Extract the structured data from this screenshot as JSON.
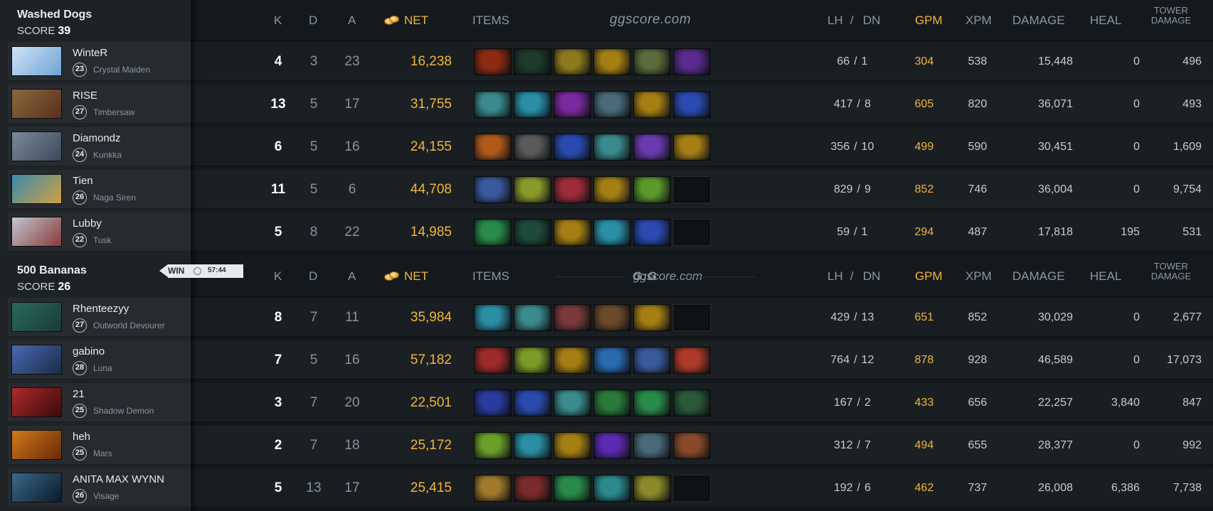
{
  "colors": {
    "gold": "#f2b53a",
    "header_gray": "#8e979e",
    "panel": "#262b2f",
    "background": "#14191d"
  },
  "watermark": {
    "top": "ggscore.com",
    "logo": "G:G",
    "logo_sub": "ggscore.com"
  },
  "columns": {
    "k": "K",
    "d": "D",
    "a": "A",
    "net": "NET",
    "items": "ITEMS",
    "lh": "LH",
    "slash": "/",
    "dn": "DN",
    "gpm": "GPM",
    "xpm": "XPM",
    "damage": "DAMAGE",
    "heal": "HEAL",
    "tower_line1": "TOWER",
    "tower_line2": "DAMAGE"
  },
  "result": {
    "label": "WIN",
    "icon": "clock-icon",
    "duration": "57:44"
  },
  "teams": [
    {
      "name": "Washed Dogs",
      "score_label": "SCORE",
      "score": "39",
      "players": [
        {
          "name": "WinteR",
          "level": "23",
          "hero": "Crystal Maiden",
          "avatar_colors": [
            "#cfe3f6",
            "#6fa3d6"
          ],
          "k": "4",
          "d": "3",
          "a": "23",
          "net": "16,238",
          "items": [
            "#8e2a12",
            "#1e3a2c",
            "#8e7a1e",
            "#a57f14",
            "#5b6b3a",
            "#5a2a8e"
          ],
          "lh": "66",
          "dn": "1",
          "gpm": "304",
          "xpm": "538",
          "damage": "15,448",
          "heal": "0",
          "tower": "496"
        },
        {
          "name": "RISE",
          "level": "27",
          "hero": "Timbersaw",
          "avatar_colors": [
            "#8a6a3a",
            "#5a2e1e"
          ],
          "k": "13",
          "d": "5",
          "a": "17",
          "net": "31,755",
          "items": [
            "#3a8a8e",
            "#2a8ea5",
            "#7a2a9e",
            "#4a6a7a",
            "#a57f14",
            "#2a4ab0"
          ],
          "lh": "417",
          "dn": "8",
          "gpm": "605",
          "xpm": "820",
          "damage": "36,071",
          "heal": "0",
          "tower": "493"
        },
        {
          "name": "Diamondz",
          "level": "24",
          "hero": "Kunkka",
          "avatar_colors": [
            "#7a8a9a",
            "#3a4a5a"
          ],
          "k": "6",
          "d": "5",
          "a": "16",
          "net": "24,155",
          "items": [
            "#b05a1a",
            "#5a5a5a",
            "#2a4ab0",
            "#3a8a8e",
            "#6a3ab0",
            "#a57f14"
          ],
          "lh": "356",
          "dn": "10",
          "gpm": "499",
          "xpm": "590",
          "damage": "30,451",
          "heal": "0",
          "tower": "1,609"
        },
        {
          "name": "Tien",
          "level": "26",
          "hero": "Naga Siren",
          "avatar_colors": [
            "#3a8ab0",
            "#d0a040"
          ],
          "k": "11",
          "d": "5",
          "a": "6",
          "net": "44,708",
          "items": [
            "#3a5a9e",
            "#8a9a2a",
            "#9e2a3a",
            "#a57f14",
            "#5a9a2a",
            ""
          ],
          "lh": "829",
          "dn": "9",
          "gpm": "852",
          "xpm": "746",
          "damage": "36,004",
          "heal": "0",
          "tower": "9,754"
        },
        {
          "name": "Lubby",
          "level": "22",
          "hero": "Tusk",
          "avatar_colors": [
            "#c0c8d0",
            "#8a3a3a"
          ],
          "k": "5",
          "d": "8",
          "a": "22",
          "net": "14,985",
          "items": [
            "#2a8a4a",
            "#1e4a3a",
            "#a57f14",
            "#2a8ea5",
            "#2a4ab0",
            ""
          ],
          "lh": "59",
          "dn": "1",
          "gpm": "294",
          "xpm": "487",
          "damage": "17,818",
          "heal": "195",
          "tower": "531"
        }
      ]
    },
    {
      "name": "500 Bananas",
      "score_label": "SCORE",
      "score": "26",
      "players": [
        {
          "name": "Rhenteezyy",
          "level": "27",
          "hero": "Outworld Devourer",
          "avatar_colors": [
            "#2a6a5a",
            "#1a3a3a"
          ],
          "k": "8",
          "d": "7",
          "a": "11",
          "net": "35,984",
          "items": [
            "#2a8ea5",
            "#3a8a8e",
            "#7a3a3a",
            "#6a4a2a",
            "#a57f14",
            ""
          ],
          "lh": "429",
          "dn": "13",
          "gpm": "651",
          "xpm": "852",
          "damage": "30,029",
          "heal": "0",
          "tower": "2,677"
        },
        {
          "name": "gabino",
          "level": "28",
          "hero": "Luna",
          "avatar_colors": [
            "#4a6ab0",
            "#1a2a4a"
          ],
          "k": "7",
          "d": "5",
          "a": "16",
          "net": "57,182",
          "items": [
            "#9e2a2a",
            "#7a9a2a",
            "#a57f14",
            "#2a6ab0",
            "#3a5a9e",
            "#b03a2a"
          ],
          "lh": "764",
          "dn": "12",
          "gpm": "878",
          "xpm": "928",
          "damage": "46,589",
          "heal": "0",
          "tower": "17,073"
        },
        {
          "name": "21",
          "level": "25",
          "hero": "Shadow Demon",
          "avatar_colors": [
            "#b02a2a",
            "#3a0a0a"
          ],
          "k": "3",
          "d": "7",
          "a": "20",
          "net": "22,501",
          "items": [
            "#2a3a9e",
            "#2a4ab0",
            "#3a8a8e",
            "#2a7a3a",
            "#2a8a4a",
            "#2a5a3a"
          ],
          "lh": "167",
          "dn": "2",
          "gpm": "433",
          "xpm": "656",
          "damage": "22,257",
          "heal": "3,840",
          "tower": "847"
        },
        {
          "name": "heh",
          "level": "25",
          "hero": "Mars",
          "avatar_colors": [
            "#d07a1a",
            "#6a2a0a"
          ],
          "k": "2",
          "d": "7",
          "a": "18",
          "net": "25,172",
          "items": [
            "#6aa02a",
            "#2a8ea5",
            "#a57f14",
            "#5a2ab0",
            "#4a6a7a",
            "#8a4a2a"
          ],
          "lh": "312",
          "dn": "7",
          "gpm": "494",
          "xpm": "655",
          "damage": "28,377",
          "heal": "0",
          "tower": "992"
        },
        {
          "name": "ANITA MAX WYNN",
          "level": "26",
          "hero": "Visage",
          "avatar_colors": [
            "#3a6a8a",
            "#0a1a2a"
          ],
          "k": "5",
          "d": "13",
          "a": "17",
          "net": "25,415",
          "items": [
            "#a07a2a",
            "#7a2a2a",
            "#2a8a4a",
            "#2a8a8e",
            "#8a8a2a",
            ""
          ],
          "lh": "192",
          "dn": "6",
          "gpm": "462",
          "xpm": "737",
          "damage": "26,008",
          "heal": "6,386",
          "tower": "7,738"
        }
      ]
    }
  ]
}
